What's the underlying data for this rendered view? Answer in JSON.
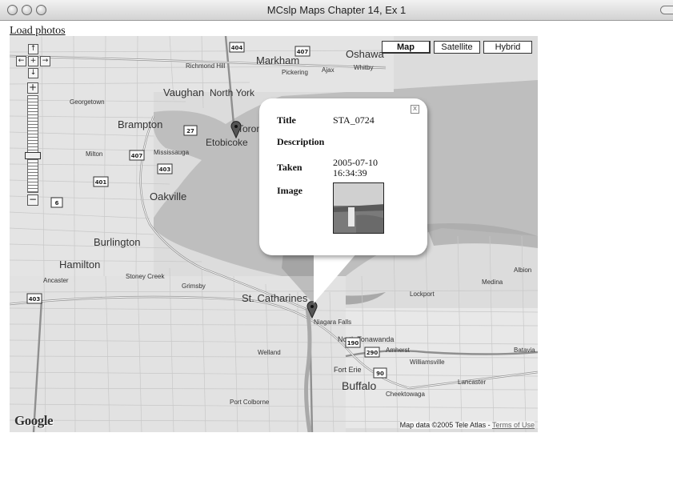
{
  "window": {
    "title": "MCslp Maps Chapter 14, Ex 1"
  },
  "page": {
    "load_photos": "Load photos"
  },
  "map": {
    "map_types": {
      "map": "Map",
      "satellite": "Satellite",
      "hybrid": "Hybrid"
    },
    "selected_type": "Map",
    "zoom_level": 6,
    "attribution": "Map data ©2005 Tele Atlas - ",
    "terms_link": "Terms of Use",
    "logo": "Google",
    "place_labels": [
      "Markham",
      "Oshawa",
      "Vaughan",
      "North York",
      "Brampton",
      "Toronto",
      "Etobicoke",
      "Oakville",
      "Burlington",
      "Hamilton",
      "St. Catharines",
      "Buffalo",
      "Ancaster",
      "Stoney Creek",
      "Grimsby",
      "Lockport",
      "North Tonawanda",
      "Niagara Falls",
      "Welland",
      "Port Colborne",
      "Fort Erie",
      "Milton",
      "Georgetown",
      "Ajax",
      "Whitby",
      "Mississauga",
      "Richmond Hill",
      "Pickering",
      "Lancaster",
      "Williamsville",
      "Medina",
      "Albion",
      "Amherst",
      "Cheektowaga",
      "Batavia"
    ],
    "highway_shields": [
      "404",
      "407",
      "27",
      "407",
      "403",
      "401",
      "6",
      "403",
      "190",
      "290",
      "90"
    ]
  },
  "info_window": {
    "title_label": "Title",
    "title_value": "STA_0724",
    "description_label": "Description",
    "description_value": "",
    "taken_label": "Taken",
    "taken_date": "2005-07-10",
    "taken_time": "16:34:39",
    "image_label": "Image",
    "close_glyph": "x"
  },
  "colors": {
    "water": "#bcbcbc",
    "land": "#dedede",
    "road": "#ffffff",
    "highway": "#9d9d9d"
  }
}
